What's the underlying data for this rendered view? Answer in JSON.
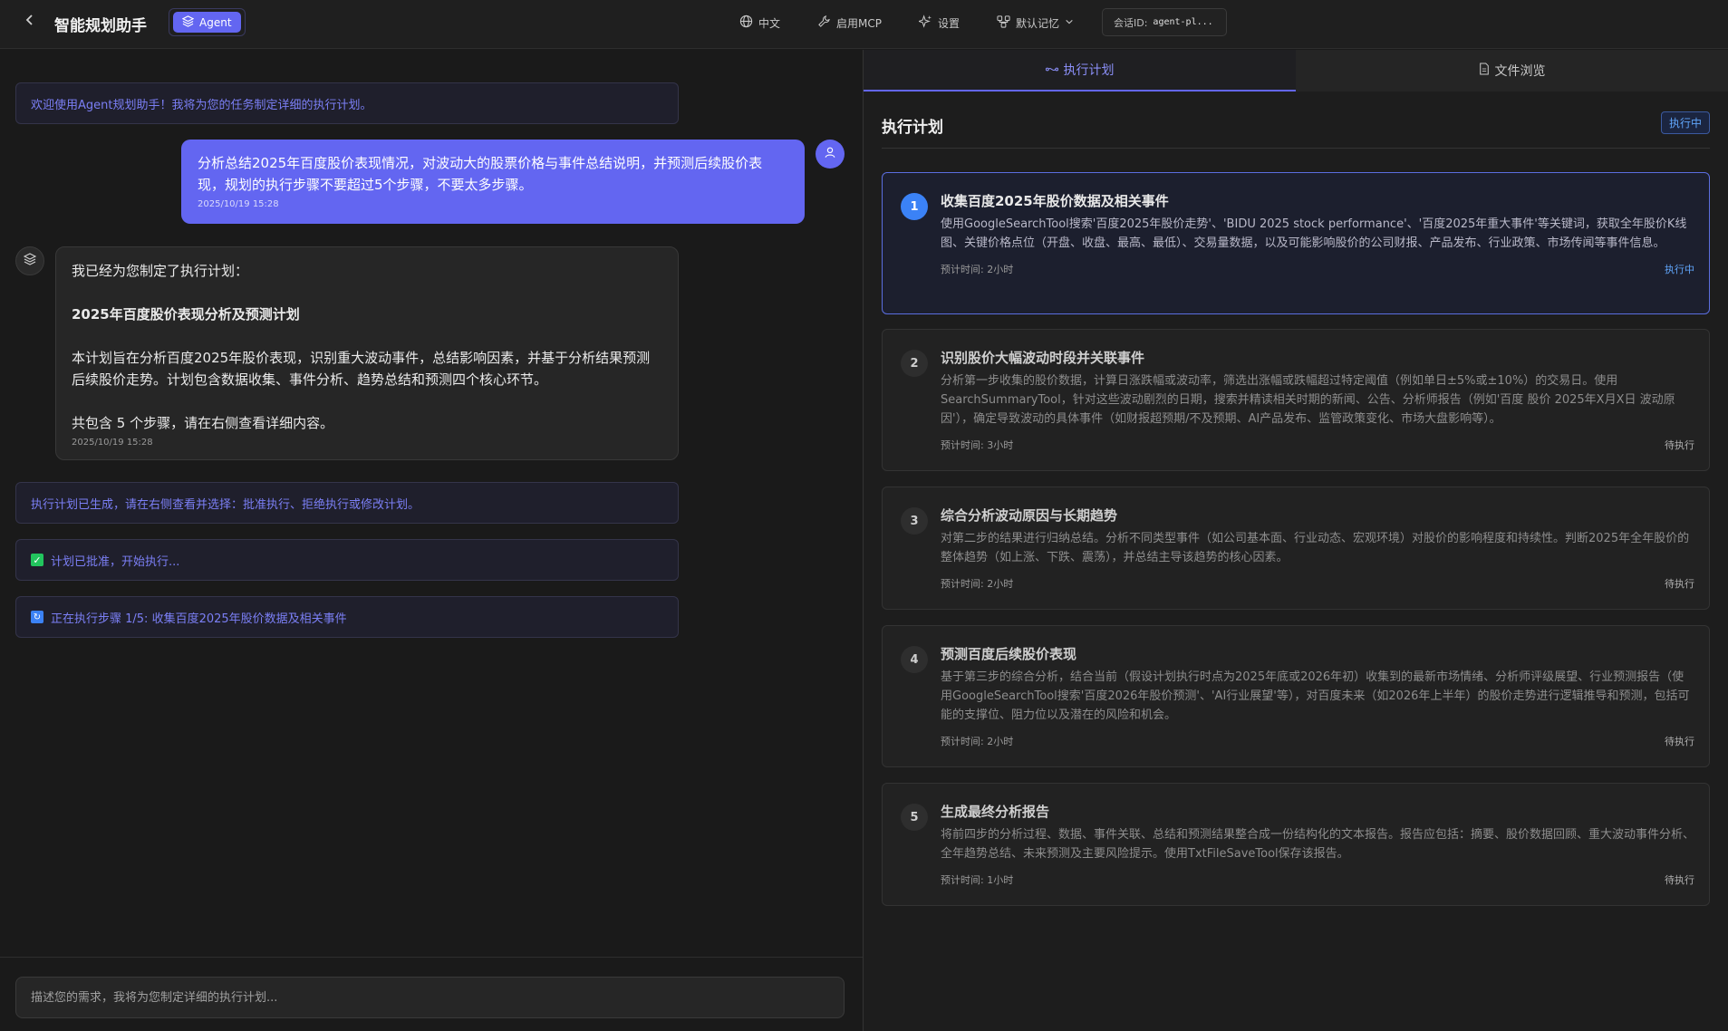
{
  "header": {
    "title": "智能规划助手",
    "agent_label": "Agent",
    "lang_label": "中文",
    "mcp_label": "启用MCP",
    "settings_label": "设置",
    "memory_label": "默认记忆",
    "session_label": "会话ID:",
    "session_id": "agent-pl..."
  },
  "chat": {
    "welcome": "欢迎使用Agent规划助手！我将为您的任务制定详细的执行计划。",
    "user_message": {
      "text": "分析总结2025年百度股价表现情况，对波动大的股票价格与事件总结说明，并预测后续股价表现，规划的执行步骤不要超过5个步骤，不要太多步骤。",
      "time": "2025/10/19 15:28"
    },
    "bot_message": {
      "line1": "我已经为您制定了执行计划：",
      "title": "2025年百度股价表现分析及预测计划",
      "body": "本计划旨在分析百度2025年股价表现，识别重大波动事件，总结影响因素，并基于分析结果预测后续股价走势。计划包含数据收集、事件分析、趋势总结和预测四个核心环节。",
      "footer": "共包含 5 个步骤，请在右侧查看详细内容。",
      "time": "2025/10/19 15:28"
    },
    "status_generated": "执行计划已生成，请在右侧查看并选择：批准执行、拒绝执行或修改计划。",
    "status_approved": "计划已批准，开始执行...",
    "status_executing": "正在执行步骤 1/5: 收集百度2025年股价数据及相关事件",
    "input_placeholder": "描述您的需求，我将为您制定详细的执行计划..."
  },
  "right": {
    "tab_plan": "执行计划",
    "tab_files": "文件浏览",
    "plan_title": "执行计划",
    "plan_status": "执行中",
    "steps": [
      {
        "num": "1",
        "title": "收集百度2025年股价数据及相关事件",
        "desc": "使用GoogleSearchTool搜索'百度2025年股价走势'、'BIDU 2025 stock performance'、'百度2025年重大事件'等关键词，获取全年股价K线图、关键价格点位（开盘、收盘、最高、最低）、交易量数据，以及可能影响股价的公司财报、产品发布、行业政策、市场传闻等事件信息。",
        "time": "预计时间: 2小时",
        "status": "执行中"
      },
      {
        "num": "2",
        "title": "识别股价大幅波动时段并关联事件",
        "desc": "分析第一步收集的股价数据，计算日涨跌幅或波动率，筛选出涨幅或跌幅超过特定阈值（例如单日±5%或±10%）的交易日。使用SearchSummaryTool，针对这些波动剧烈的日期，搜索并精读相关时期的新闻、公告、分析师报告（例如'百度 股价 2025年X月X日 波动原因'），确定导致波动的具体事件（如财报超预期/不及预期、AI产品发布、监管政策变化、市场大盘影响等）。",
        "time": "预计时间: 3小时",
        "status": "待执行"
      },
      {
        "num": "3",
        "title": "综合分析波动原因与长期趋势",
        "desc": "对第二步的结果进行归纳总结。分析不同类型事件（如公司基本面、行业动态、宏观环境）对股价的影响程度和持续性。判断2025年全年股价的整体趋势（如上涨、下跌、震荡），并总结主导该趋势的核心因素。",
        "time": "预计时间: 2小时",
        "status": "待执行"
      },
      {
        "num": "4",
        "title": "预测百度后续股价表现",
        "desc": "基于第三步的综合分析，结合当前（假设计划执行时点为2025年底或2026年初）收集到的最新市场情绪、分析师评级展望、行业预测报告（使用GoogleSearchTool搜索'百度2026年股价预测'、'AI行业展望'等），对百度未来（如2026年上半年）的股价走势进行逻辑推导和预测，包括可能的支撑位、阻力位以及潜在的风险和机会。",
        "time": "预计时间: 2小时",
        "status": "待执行"
      },
      {
        "num": "5",
        "title": "生成最终分析报告",
        "desc": "将前四步的分析过程、数据、事件关联、总结和预测结果整合成一份结构化的文本报告。报告应包括：摘要、股价数据回顾、重大波动事件分析、全年趋势总结、未来预测及主要风险提示。使用TxtFileSaveTool保存该报告。",
        "time": "预计时间: 1小时",
        "status": "待执行"
      }
    ]
  }
}
